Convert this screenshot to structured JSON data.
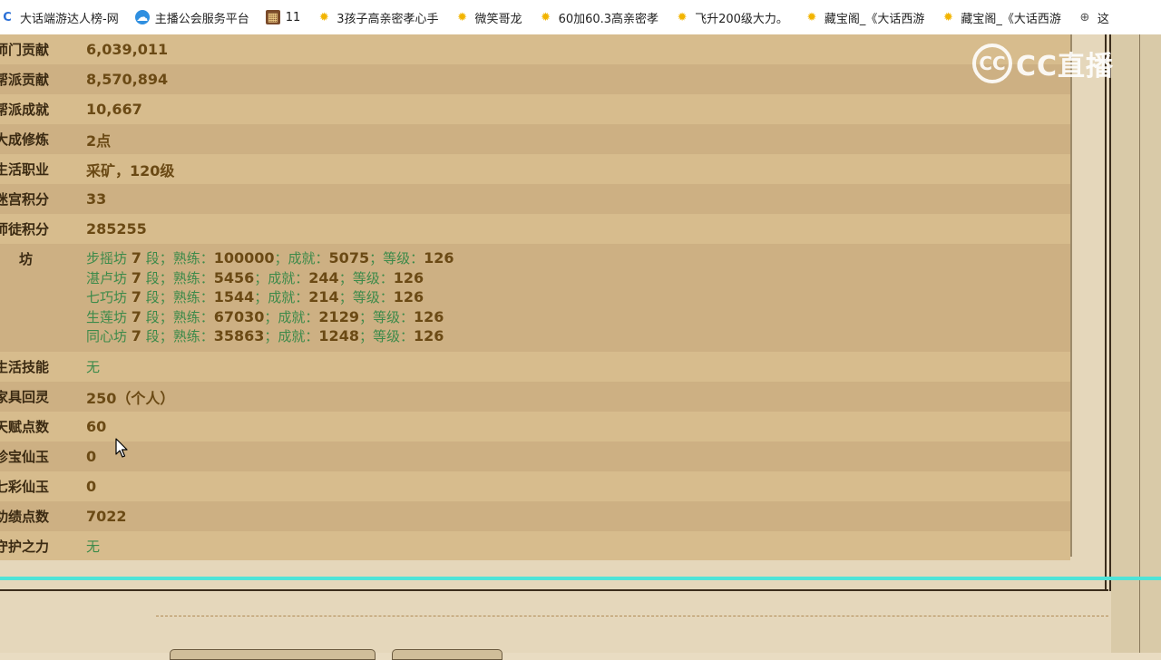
{
  "bookmarks": [
    {
      "icon": "c-icon",
      "label": "大话端游达人榜-网"
    },
    {
      "icon": "cloud-icon",
      "label": "主播公会服务平台"
    },
    {
      "icon": "game-image-icon",
      "label": "11"
    },
    {
      "icon": "star-icon",
      "label": "3孩子高亲密孝心手"
    },
    {
      "icon": "star-icon",
      "label": "微笑哥龙"
    },
    {
      "icon": "star-icon",
      "label": "60加60.3高亲密孝"
    },
    {
      "icon": "star-icon",
      "label": "飞升200级大力。"
    },
    {
      "icon": "star-icon",
      "label": "藏宝阁_《大话西游"
    },
    {
      "icon": "star-icon",
      "label": "藏宝阁_《大话西游"
    },
    {
      "icon": "globe-icon",
      "label": "这"
    }
  ],
  "watermark": {
    "logo": "CC",
    "text": "CC直播"
  },
  "rows": [
    {
      "label": "师门贡献",
      "value": "6,039,011"
    },
    {
      "label": "帮派贡献",
      "value": "8,570,894"
    },
    {
      "label": "帮派成就",
      "value": "10,667"
    },
    {
      "label": "大成修炼",
      "value": "2点"
    },
    {
      "label": "生活职业",
      "value": "采矿，120级"
    },
    {
      "label": "迷宫积分",
      "value": "33"
    },
    {
      "label": "师徒积分",
      "value": "285255"
    }
  ],
  "shops": {
    "label": "作 坊",
    "lines": [
      {
        "name": "步摇坊",
        "level": "7",
        "duan": "段；熟练：",
        "shulian": "100000",
        "cj": "；成就：",
        "chengjiu": "5075",
        "dj": "；等级：",
        "dengji": "126"
      },
      {
        "name": "湛卢坊",
        "level": "7",
        "duan": "段；熟练：",
        "shulian": "5456",
        "cj": "；成就：",
        "chengjiu": "244",
        "dj": "；等级：",
        "dengji": "126"
      },
      {
        "name": "七巧坊",
        "level": "7",
        "duan": "段；熟练：",
        "shulian": "1544",
        "cj": "；成就：",
        "chengjiu": "214",
        "dj": "；等级：",
        "dengji": "126"
      },
      {
        "name": "生莲坊",
        "level": "7",
        "duan": "段；熟练：",
        "shulian": "67030",
        "cj": "；成就：",
        "chengjiu": "2129",
        "dj": "；等级：",
        "dengji": "126"
      },
      {
        "name": "同心坊",
        "level": "7",
        "duan": "段；熟练：",
        "shulian": "35863",
        "cj": "；成就：",
        "chengjiu": "1248",
        "dj": "；等级：",
        "dengji": "126"
      }
    ]
  },
  "rows2": [
    {
      "label": "生活技能",
      "value": "无",
      "green": true
    },
    {
      "label": "家具回灵",
      "value": "250（个人）"
    },
    {
      "label": "天赋点数",
      "value": "60"
    },
    {
      "label": "珍宝仙玉",
      "value": "0"
    },
    {
      "label": "七彩仙玉",
      "value": "0"
    },
    {
      "label": "功绩点数",
      "value": "7022"
    },
    {
      "label": "守护之力",
      "value": "无",
      "green": true
    }
  ]
}
